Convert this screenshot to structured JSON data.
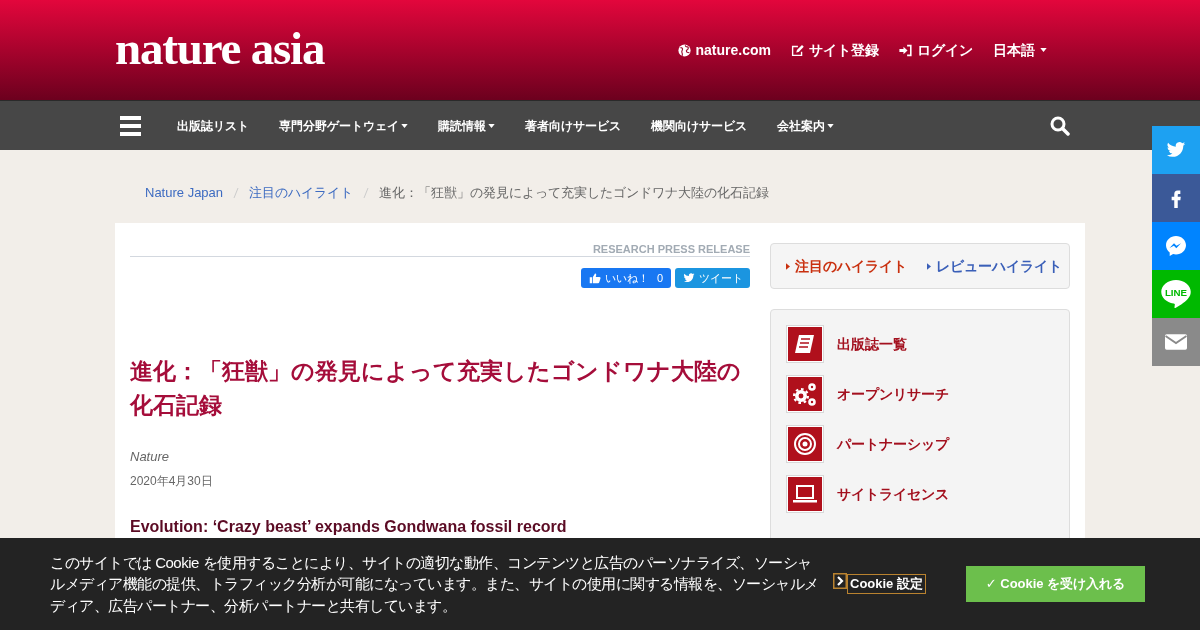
{
  "header": {
    "logo": "nature asia",
    "links": [
      {
        "kind": "globe",
        "label": "nature.com"
      },
      {
        "kind": "edit",
        "label": "サイト登録"
      },
      {
        "kind": "signin",
        "label": "ログイン"
      },
      {
        "kind": "dropdown",
        "label": "日本語"
      }
    ]
  },
  "nav": {
    "items": [
      {
        "label": "出版誌リスト",
        "dropdown": false
      },
      {
        "label": "専門分野ゲートウェイ",
        "dropdown": true
      },
      {
        "label": "購読情報",
        "dropdown": true
      },
      {
        "label": "著者向けサービス",
        "dropdown": false
      },
      {
        "label": "機関向けサービス",
        "dropdown": false
      },
      {
        "label": "会社案内",
        "dropdown": true
      }
    ]
  },
  "social_buttons": [
    {
      "kind": "twitter"
    },
    {
      "kind": "facebook"
    },
    {
      "kind": "messenger"
    },
    {
      "kind": "line",
      "text": "LINE"
    },
    {
      "kind": "mail"
    }
  ],
  "breadcrumb": [
    {
      "label": "Nature Japan",
      "current": false
    },
    {
      "label": "注目のハイライト",
      "current": false
    },
    {
      "label": "進化：「狂獣」の発見によって充実したゴンドワナ大陸の化石記録",
      "current": true
    }
  ],
  "article": {
    "section_label": "RESEARCH PRESS RELEASE",
    "like_button": {
      "label": "いいね！",
      "count": "0"
    },
    "tweet_button": {
      "label": "ツイート"
    },
    "title": "進化：「狂獣」の発見によって充実したゴンドワナ大陸の化石記録",
    "journal": "Nature",
    "date": "2020年4月30日",
    "english_title": "Evolution: ‘Crazy beast’ expands Gondwana fossil record"
  },
  "sidebar": {
    "tabs": [
      {
        "label": "注目のハイライト",
        "selected": true
      },
      {
        "label": "レビューハイライト",
        "selected": false
      }
    ],
    "links": [
      {
        "kind": "book",
        "label": "出版誌一覧"
      },
      {
        "kind": "gears",
        "label": "オープンリサーチ"
      },
      {
        "kind": "target",
        "label": "パートナーシップ"
      },
      {
        "kind": "laptop",
        "label": "サイトライセンス"
      }
    ]
  },
  "cookie_banner": {
    "message": "このサイトでは Cookie を使用することにより、サイトの適切な動作、コンテンツと広告のパーソナライズ、ソーシャルメディア機能の提供、トラフィック分析が可能になっています。また、サイトの使用に関する情報を、ソーシャルメディア、広告パートナー、分析パートナーと共有しています。",
    "settings_button": "Cookie 設定",
    "accept_button": "✓ Cookie を受け入れる"
  }
}
